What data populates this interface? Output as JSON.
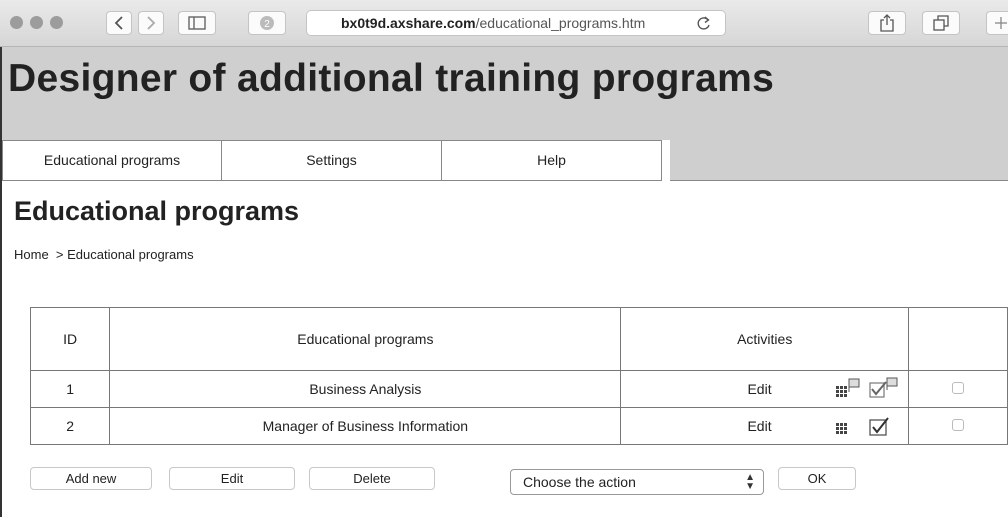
{
  "browser": {
    "url_host": "bx0t9d.axshare.com",
    "url_path": "/educational_programs.htm"
  },
  "app": {
    "title": "Designer of additional training programs"
  },
  "nav": {
    "tabs": [
      {
        "label": "Educational programs"
      },
      {
        "label": "Settings"
      },
      {
        "label": "Help"
      }
    ]
  },
  "page": {
    "title": "Educational programs",
    "breadcrumb": "Home  > Educational programs"
  },
  "table": {
    "headers": {
      "id": "ID",
      "program": "Educational programs",
      "activities": "Activities",
      "select": ""
    },
    "rows": [
      {
        "id": "1",
        "program": "Business Analysis",
        "action": "Edit",
        "icons": [
          "grid-flag-icon",
          "check-flag-icon"
        ],
        "checked": false
      },
      {
        "id": "2",
        "program": "Manager of Business Information",
        "action": "Edit",
        "icons": [
          "grid-icon",
          "check-icon"
        ],
        "checked": false
      }
    ]
  },
  "actions": {
    "add_new": "Add new",
    "edit": "Edit",
    "delete": "Delete",
    "choose_action": "Choose the action",
    "ok": "OK"
  }
}
